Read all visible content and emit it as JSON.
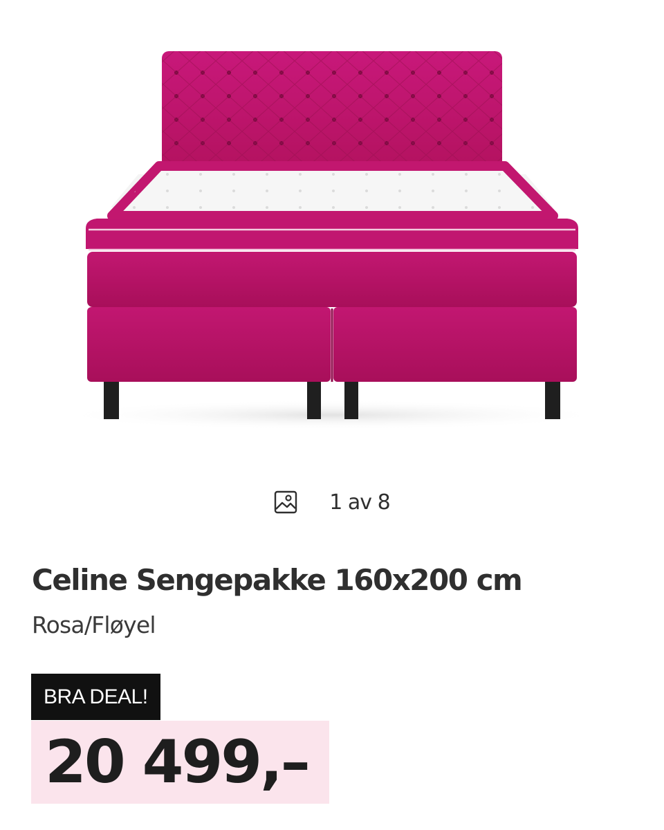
{
  "product": {
    "title": "Celine Sengepakke 160x200 cm",
    "variant": "Rosa/Fløyel",
    "badge": "BRA DEAL!",
    "price": "20 499,–"
  },
  "gallery": {
    "counter": "1 av 8",
    "icon": "image-icon",
    "image_subject": "bed-image"
  },
  "colors": {
    "velvet": "#c2176f",
    "badge_bg": "#111111",
    "price_bg": "#fbe4ec"
  }
}
